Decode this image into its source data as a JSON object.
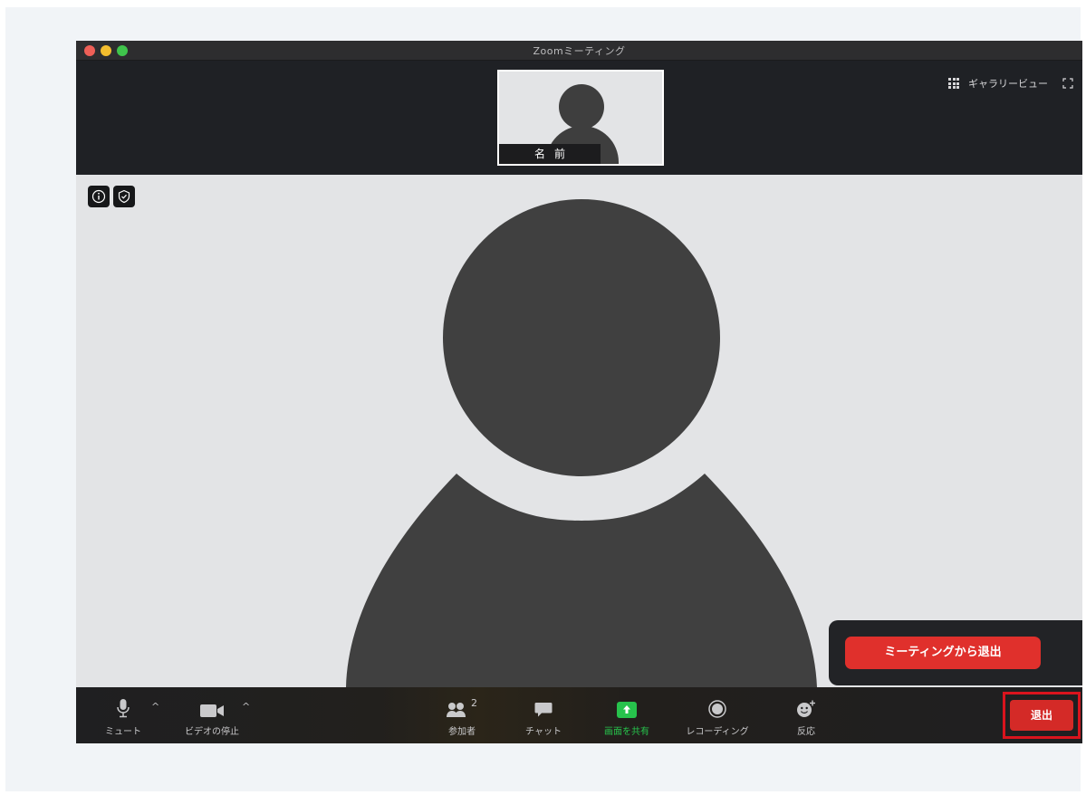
{
  "window": {
    "title": "Zoomミーティング"
  },
  "thumbnail": {
    "name_label": "名前"
  },
  "view_controls": {
    "gallery_label": "ギャラリービュー"
  },
  "popup": {
    "leave_meeting_label": "ミーティングから退出"
  },
  "toolbar": {
    "mute_label": "ミュート",
    "video_label": "ビデオの停止",
    "participants_label": "参加者",
    "participants_count": "2",
    "chat_label": "チャット",
    "share_label": "画面を共有",
    "record_label": "レコーディング",
    "reactions_label": "反応",
    "leave_label": "退出"
  },
  "colors": {
    "leave_red": "#e0302c",
    "share_green": "#27c24c",
    "highlight_border": "#d9141d"
  }
}
